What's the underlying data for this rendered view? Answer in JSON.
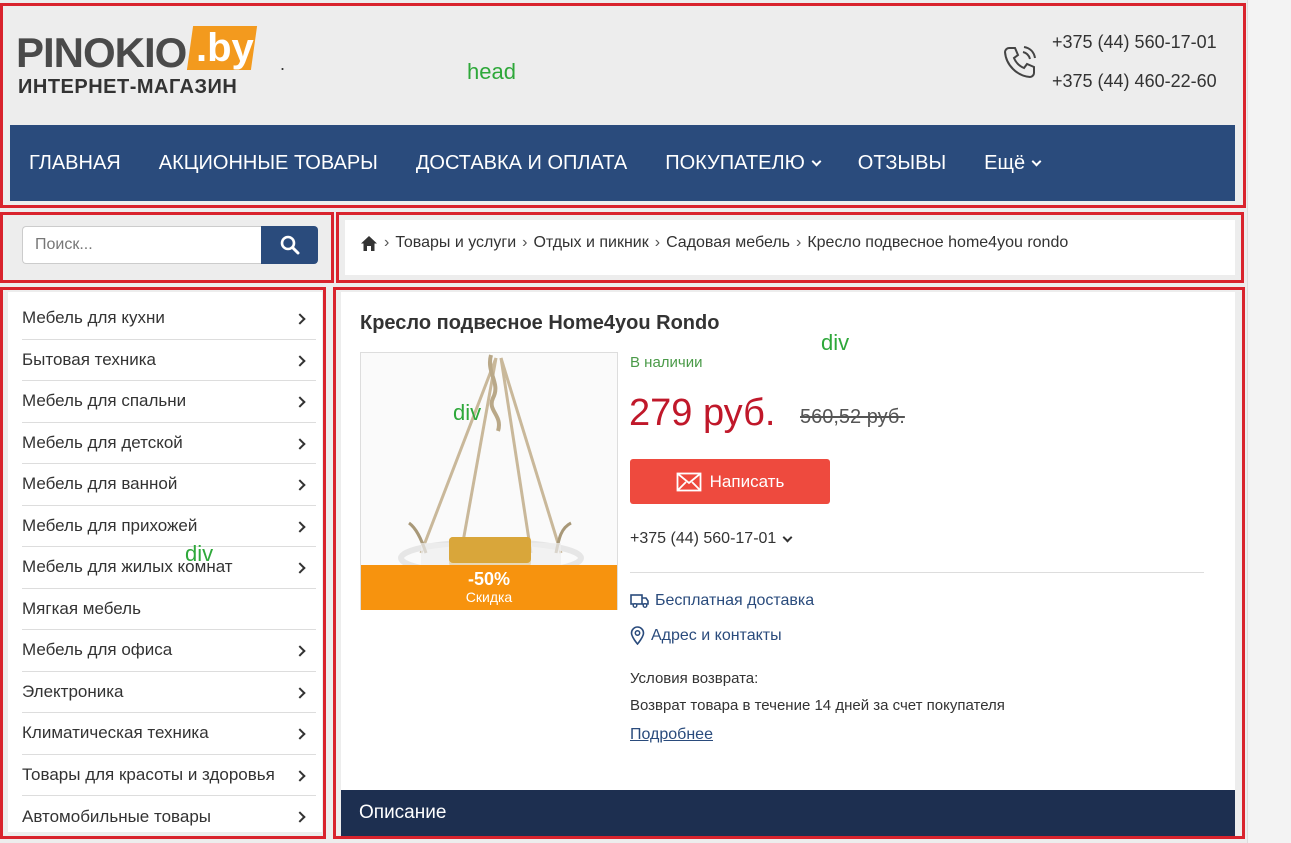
{
  "header": {
    "logo_word": "PINOKIO",
    "logo_domain": ".by",
    "logo_sub": "ИНТЕРНЕТ-МАГАЗИН",
    "dot": ".",
    "phones": [
      "+375 (44) 560-17-01",
      "+375 (44) 460-22-60"
    ]
  },
  "nav": {
    "items": [
      {
        "label": "ГЛАВНАЯ",
        "dropdown": false
      },
      {
        "label": "АКЦИОННЫЕ ТОВАРЫ",
        "dropdown": false
      },
      {
        "label": "ДОСТАВКА И ОПЛАТА",
        "dropdown": false
      },
      {
        "label": "ПОКУПАТЕЛЮ",
        "dropdown": true
      },
      {
        "label": "ОТЗЫВЫ",
        "dropdown": false
      },
      {
        "label": "Ещё",
        "dropdown": true
      }
    ]
  },
  "search": {
    "placeholder": "Поиск..."
  },
  "breadcrumb": [
    "Товары и услуги",
    "Отдых и пикник",
    "Садовая мебель",
    "Кресло подвесное home4you rondo"
  ],
  "sidebar": {
    "items": [
      {
        "label": "Мебель для кухни",
        "arrow": true
      },
      {
        "label": "Бытовая техника",
        "arrow": true
      },
      {
        "label": "Мебель для спальни",
        "arrow": true
      },
      {
        "label": "Мебель для детской",
        "arrow": true
      },
      {
        "label": "Мебель для ванной",
        "arrow": true
      },
      {
        "label": "Мебель для прихожей",
        "arrow": true
      },
      {
        "label": "Мебель для жилых комнат",
        "arrow": true
      },
      {
        "label": "Мягкая мебель",
        "arrow": false
      },
      {
        "label": "Мебель для офиса",
        "arrow": true
      },
      {
        "label": "Электроника",
        "arrow": true
      },
      {
        "label": "Климатическая техника",
        "arrow": true
      },
      {
        "label": "Товары для красоты и здоровья",
        "arrow": true
      },
      {
        "label": "Автомобильные товары",
        "arrow": true
      }
    ]
  },
  "product": {
    "title": "Кресло подвесное Home4you Rondo",
    "stock": "В наличии",
    "price": "279 руб.",
    "old_price": "560,52 руб.",
    "discount_pct": "-50%",
    "discount_label": "Скидка",
    "write_button": "Написать",
    "phone": "+375 (44) 560-17-01",
    "delivery_link": "Бесплатная доставка",
    "address_link": "Адрес и контакты",
    "return_label": "Условия возврата:",
    "return_text": "Возврат товара в течение 14 дней за счет покупателя",
    "more_link": "Подробнее"
  },
  "description_tab": "Описание",
  "annotations": {
    "head": "head",
    "div_main": "div",
    "div_image": "div",
    "div_sidebar": "div"
  },
  "colors": {
    "nav_bg": "#2a4b7c",
    "price": "#c0182a",
    "button": "#ee4a3e",
    "discount": "#f7930e",
    "annotation_box": "#d9232d",
    "annotation_text": "#2ea83a"
  }
}
